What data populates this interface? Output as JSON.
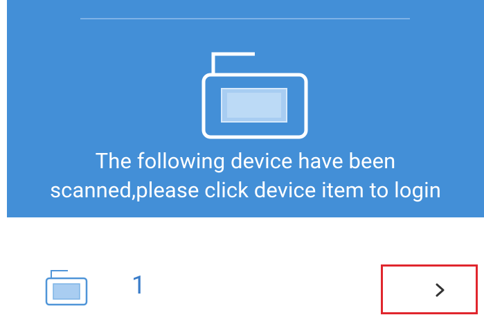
{
  "header": {
    "message_line1": "The following device have been",
    "message_line2": "scanned,please click device item to login"
  },
  "icons": {
    "device_illustration": "device-icon",
    "row_device": "device-icon",
    "row_arrow": "chevron-right-icon"
  },
  "devices": [
    {
      "name": "1"
    }
  ],
  "colors": {
    "header_background": "#438fd7",
    "header_text": "#ffffff",
    "device_name": "#3b7dc9",
    "highlight_box": "#e0262d",
    "chevron": "#333333"
  }
}
